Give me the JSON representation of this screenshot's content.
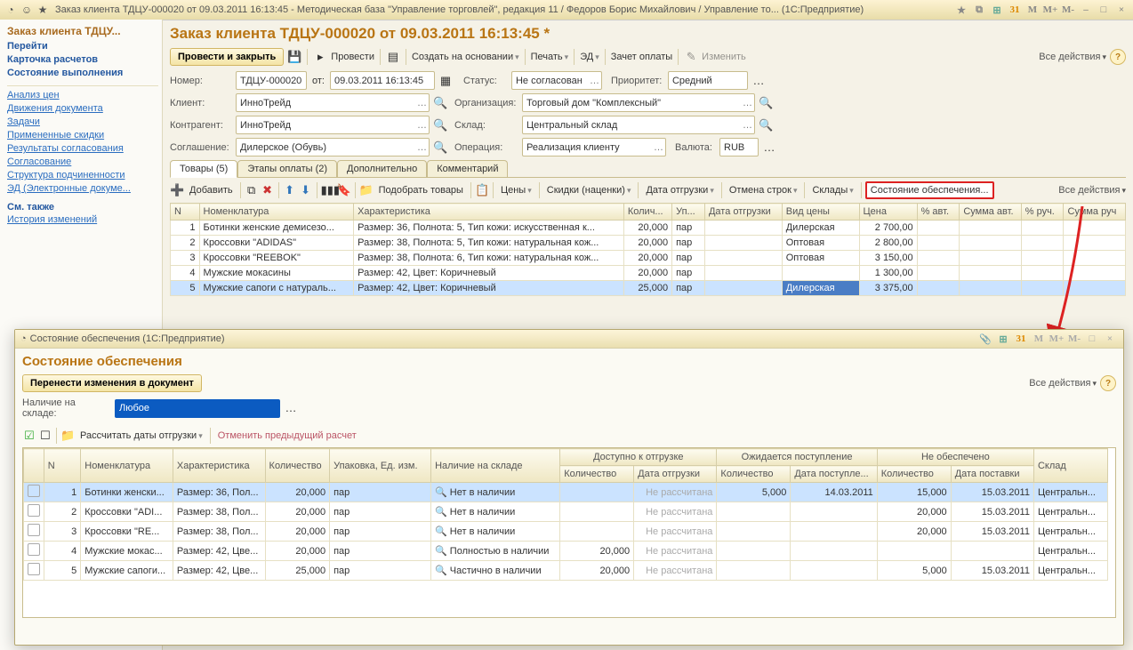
{
  "app": {
    "title": "Заказ клиента ТДЦУ-000020 от 09.03.2011 16:13:45 - Методическая база \"Управление торговлей\", редакция 11 / Федоров Борис Михайлович / Управление то...  (1С:Предприятие)",
    "title_icons_r": [
      "M",
      "M+",
      "M-"
    ]
  },
  "sidebar": {
    "title": "Заказ клиента ТДЦУ...",
    "goto": "Перейти",
    "bold1": "Карточка расчетов",
    "bold2": "Состояние выполнения",
    "links": [
      "Анализ цен",
      "Движения документа",
      "Задачи",
      "Примененные скидки",
      "Результаты согласования",
      "Согласование",
      "Структура подчиненности",
      "ЭД (Электронные докуме..."
    ],
    "see_also": "См. также",
    "links2": [
      "История изменений"
    ]
  },
  "header": {
    "title": "Заказ клиента ТДЦУ-000020 от 09.03.2011 16:13:45 *",
    "save_close": "Провести и закрыть",
    "post": "Провести",
    "create_by": "Создать на основании",
    "print": "Печать",
    "ed": "ЭД",
    "pay_offset": "Зачет оплаты",
    "change": "Изменить",
    "all_actions": "Все действия"
  },
  "form": {
    "number_lbl": "Номер:",
    "number": "ТДЦУ-000020",
    "from": "от:",
    "date": "09.03.2011 16:13:45",
    "status_lbl": "Статус:",
    "status": "Не согласован",
    "priority_lbl": "Приоритет:",
    "priority": "Средний",
    "client_lbl": "Клиент:",
    "client": "ИнноТрейд",
    "org_lbl": "Организация:",
    "org": "Торговый дом \"Комплексный\"",
    "counter_lbl": "Контрагент:",
    "counter": "ИнноТрейд",
    "store_lbl": "Склад:",
    "store": "Центральный склад",
    "agreement_lbl": "Соглашение:",
    "agreement": "Дилерское (Обувь)",
    "op_lbl": "Операция:",
    "op": "Реализация клиенту",
    "cur_lbl": "Валюта:",
    "cur": "RUB"
  },
  "tabs": {
    "t1": "Товары (5)",
    "t2": "Этапы оплаты (2)",
    "t3": "Дополнительно",
    "t4": "Комментарий"
  },
  "itemsbar": {
    "add": "Добавить",
    "pick": "Подобрать товары",
    "prices": "Цены",
    "disc": "Скидки (наценки)",
    "shipdate": "Дата отгрузки",
    "cancel": "Отмена строк",
    "stores": "Склады",
    "state": "Состояние обеспечения...",
    "all": "Все действия"
  },
  "grid": {
    "cols": [
      "N",
      "Номенклатура",
      "Характеристика",
      "Колич...",
      "Уп...",
      "Дата отгрузки",
      "Вид цены",
      "Цена",
      "% авт.",
      "Сумма авт.",
      "% руч.",
      "Сумма руч"
    ],
    "rows": [
      {
        "n": "1",
        "nom": "Ботинки женские демисезо...",
        "char": "Размер: 36, Полнота: 5, Тип кожи: искусственная к...",
        "qty": "20,000",
        "pack": "пар",
        "date": "",
        "ptype": "Дилерская",
        "price": "2 700,00"
      },
      {
        "n": "2",
        "nom": "Кроссовки \"ADIDAS\"",
        "char": "Размер: 38, Полнота: 5, Тип кожи: натуральная кож...",
        "qty": "20,000",
        "pack": "пар",
        "date": "",
        "ptype": "Оптовая",
        "price": "2 800,00"
      },
      {
        "n": "3",
        "nom": "Кроссовки \"REEBOK\"",
        "char": "Размер: 38, Полнота: 6, Тип кожи: натуральная кож...",
        "qty": "20,000",
        "pack": "пар",
        "date": "",
        "ptype": "Оптовая",
        "price": "3 150,00"
      },
      {
        "n": "4",
        "nom": "Мужские мокасины",
        "char": "Размер: 42, Цвет: Коричневый",
        "qty": "20,000",
        "pack": "пар",
        "date": "",
        "ptype": "",
        "price": "1 300,00"
      },
      {
        "n": "5",
        "nom": "Мужские сапоги с натураль...",
        "char": "Размер: 42, Цвет: Коричневый",
        "qty": "25,000",
        "pack": "пар",
        "date": "",
        "ptype": "Дилерская",
        "price": "3 375,00"
      }
    ]
  },
  "sub": {
    "title_win": "Состояние обеспечения  (1С:Предприятие)",
    "title": "Состояние обеспечения",
    "apply": "Перенести изменения в документ",
    "all": "Все действия",
    "stock_lbl": "Наличие на складе:",
    "stock": "Любое",
    "calc": "Рассчитать даты отгрузки",
    "undo": "Отменить предыдущий расчет",
    "cols_top": [
      "",
      "N",
      "Номенклатура",
      "Характеристика",
      "Количество",
      "Упаковка, Ед. изм.",
      "Наличие на складе",
      "Доступно к отгрузке",
      "Ожидается поступление",
      "Не обеспечено",
      "Склад"
    ],
    "cols_sub": [
      "Количество",
      "Дата отгрузки",
      "Количество",
      "Дата поступле...",
      "Количество",
      "Дата поставки"
    ],
    "not_calc": "Не рассчитана",
    "rows": [
      {
        "n": "1",
        "nom": "Ботинки женски...",
        "char": "Размер: 36, Пол...",
        "qty": "20,000",
        "pack": "пар",
        "stock": "Нет в наличии",
        "aq": "",
        "ad": "",
        "eq": "5,000",
        "ed": "14.03.2011",
        "uq": "15,000",
        "ud": "15.03.2011",
        "store": "Центральн..."
      },
      {
        "n": "2",
        "nom": "Кроссовки \"ADI...",
        "char": "Размер: 38, Пол...",
        "qty": "20,000",
        "pack": "пар",
        "stock": "Нет в наличии",
        "aq": "",
        "ad": "",
        "eq": "",
        "ed": "",
        "uq": "20,000",
        "ud": "15.03.2011",
        "store": "Центральн..."
      },
      {
        "n": "3",
        "nom": "Кроссовки \"RE...",
        "char": "Размер: 38, Пол...",
        "qty": "20,000",
        "pack": "пар",
        "stock": "Нет в наличии",
        "aq": "",
        "ad": "",
        "eq": "",
        "ed": "",
        "uq": "20,000",
        "ud": "15.03.2011",
        "store": "Центральн..."
      },
      {
        "n": "4",
        "nom": "Мужские мокас...",
        "char": "Размер: 42, Цве...",
        "qty": "20,000",
        "pack": "пар",
        "stock": "Полностью в наличии",
        "aq": "20,000",
        "ad": "",
        "eq": "",
        "ed": "",
        "uq": "",
        "ud": "",
        "store": "Центральн..."
      },
      {
        "n": "5",
        "nom": "Мужские сапоги...",
        "char": "Размер: 42, Цве...",
        "qty": "25,000",
        "pack": "пар",
        "stock": "Частично в наличии",
        "aq": "20,000",
        "ad": "",
        "eq": "",
        "ed": "",
        "uq": "5,000",
        "ud": "15.03.2011",
        "store": "Центральн..."
      }
    ]
  }
}
